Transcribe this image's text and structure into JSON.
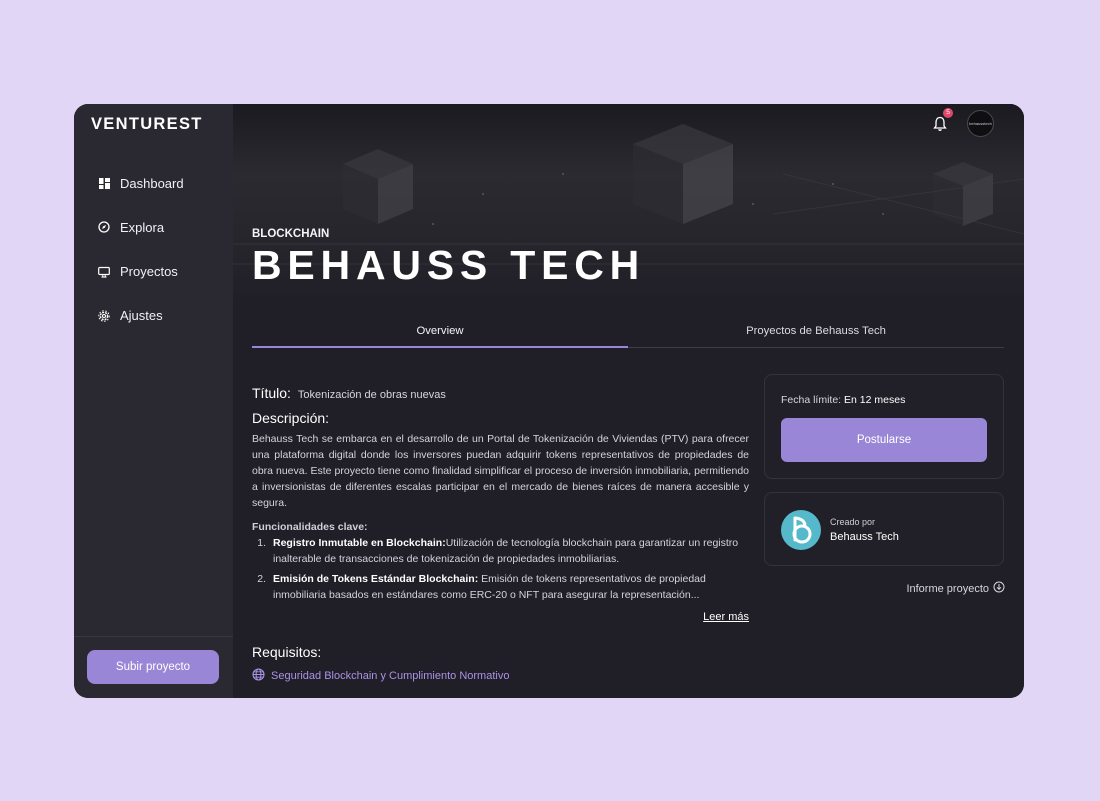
{
  "app": {
    "logo": "VENTUREST"
  },
  "sidebar": {
    "items": [
      {
        "label": "Dashboard",
        "icon": "dashboard-icon"
      },
      {
        "label": "Explora",
        "icon": "compass-icon"
      },
      {
        "label": "Proyectos",
        "icon": "monitor-icon"
      },
      {
        "label": "Ajustes",
        "icon": "gear-icon"
      }
    ],
    "upload_button": "Subir proyecto"
  },
  "topbar": {
    "notification_count": "5",
    "avatar_text": "behausstech"
  },
  "hero": {
    "category": "BLOCKCHAIN",
    "company_name": "BEHAUSS TECH"
  },
  "tabs": [
    {
      "label": "Overview",
      "active": true
    },
    {
      "label": "Proyectos de Behauss Tech",
      "active": false
    }
  ],
  "overview": {
    "titulo_label": "Título:",
    "titulo_value": "Tokenización de obras nuevas",
    "descripcion_label": "Descripción:",
    "descripcion_text": "Behauss Tech se embarca en el desarrollo de un Portal de Tokenización de Viviendas (PTV) para ofrecer una plataforma digital donde los inversores puedan adquirir tokens representativos de propiedades de obra nueva. Este proyecto tiene como finalidad simplificar el proceso de inversión inmobiliaria, permitiendo a inversionistas de diferentes escalas participar en el mercado de bienes raíces de manera accesible y segura.",
    "funcionalidades_label": "Funcionalidades clave:",
    "funcionalidades": [
      {
        "num": "1.",
        "title": "Registro Inmutable en Blockchain:",
        "text": "Utilización de tecnología blockchain para garantizar un registro inalterable de transacciones de tokenización de propiedades inmobiliarias."
      },
      {
        "num": "2.",
        "title": "Emisión de Tokens Estándar Blockchain:",
        "text": " Emisión de tokens representativos de propiedad inmobiliaria basados en estándares como ERC-20 o NFT para asegurar la representación..."
      }
    ],
    "leer_mas": "Leer más",
    "requisitos_label": "Requisitos:",
    "requisitos": [
      "Seguridad Blockchain y Cumplimiento Normativo"
    ]
  },
  "application_card": {
    "fecha_label": "Fecha límite:",
    "fecha_value": "En 12 meses",
    "button": "Postularse"
  },
  "creator_card": {
    "label": "Creado por",
    "name": "Behauss Tech"
  },
  "report_link": "Informe proyecto",
  "colors": {
    "accent": "#9a86d6",
    "background": "#e2d6f6",
    "panel": "#201e26",
    "sidebar": "#2a2831",
    "badge": "#e0486b",
    "creator_avatar": "#55b9cb"
  }
}
